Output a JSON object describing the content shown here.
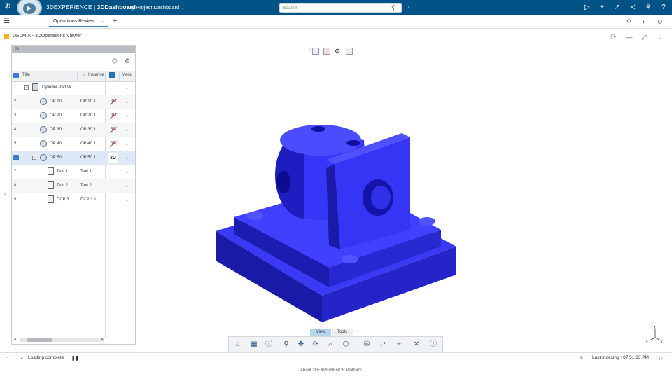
{
  "topbar": {
    "brand_icon": "ds-logo-icon",
    "app_title_light": "3DEXPERIENCE | ",
    "app_title_bold": "3DDashboard",
    "dashboard_name": "My Project Dashboard",
    "search_placeholder": "Search",
    "compass_label": "V,R"
  },
  "tabs": {
    "active": "Operations Review"
  },
  "widget": {
    "title": "DELMIA - 3DOperations Viewer"
  },
  "tree": {
    "columns": {
      "title": "Title",
      "instance": "Instance",
      "menu": "Menu"
    },
    "rows": [
      {
        "num": "1",
        "title": "Cylinder Pad W...",
        "instance": ""
      },
      {
        "num": "2",
        "title": "OP 10",
        "instance": "OP 10.1"
      },
      {
        "num": "3",
        "title": "OP 20",
        "instance": "OP 20.1"
      },
      {
        "num": "4",
        "title": "OP 30",
        "instance": "OP 30.1"
      },
      {
        "num": "5",
        "title": "OP 40",
        "instance": "OP 40.1"
      },
      {
        "num": "6",
        "title": "OP 50",
        "instance": "OP 50.1"
      },
      {
        "num": "7",
        "title": "Text 1",
        "instance": "Text 1.1"
      },
      {
        "num": "8",
        "title": "Text 2",
        "instance": "Text 2.1"
      },
      {
        "num": "9",
        "title": "DCP 3",
        "instance": "DCP 3.1"
      }
    ],
    "btn_3d": "3D"
  },
  "viewer": {
    "tab_view": "View",
    "tab_tools": "Tools",
    "model_color": "#2222ff",
    "axes": {
      "x": "x",
      "y": "y",
      "z": "z"
    }
  },
  "status": {
    "loading": "Loading complete",
    "indexing": "Last Indexing : 07:51:33 PM"
  },
  "footer": {
    "about": "About 3DEXPERIENCE Platform"
  }
}
